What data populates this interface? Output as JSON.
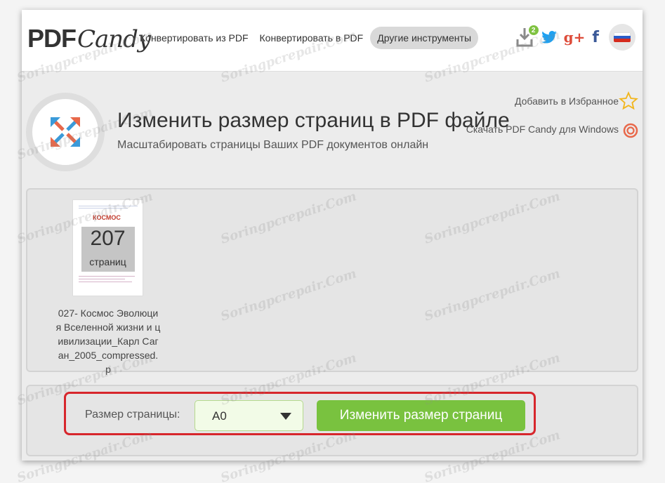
{
  "logo": {
    "pdf": "PDF",
    "candy": "Candy"
  },
  "nav": [
    {
      "label": "Конвертировать из PDF"
    },
    {
      "label": "Конвертировать в PDF"
    },
    {
      "label": "Другие инструменты"
    }
  ],
  "header_icons": {
    "download_badge": "2",
    "gplus": "g+",
    "facebook": "f"
  },
  "page": {
    "title": "Изменить размер страниц в PDF файле",
    "subtitle": "Масштабировать страницы Ваших PDF документов онлайн",
    "favorite_link": "Добавить в Избранное",
    "windows_link": "Скачать PDF Candy для Windows"
  },
  "file": {
    "thumb_title": "КОСМОС",
    "page_count": "207",
    "pages_label": "страниц",
    "name": "027- Космос Эволюция Вселенной жизни и цивилизации_Карл Саган_2005_compressed.p"
  },
  "options": {
    "page_size_label": "Размер страницы:",
    "page_size_value": "A0",
    "submit_label": "Изменить размер страниц"
  },
  "watermark": "Soringpcrepair.Com",
  "colors": {
    "accent_green": "#79c23f",
    "highlight_red": "#d7262c",
    "twitter_blue": "#1da1f2",
    "gplus_red": "#dd4b39",
    "facebook_blue": "#3b5998"
  }
}
